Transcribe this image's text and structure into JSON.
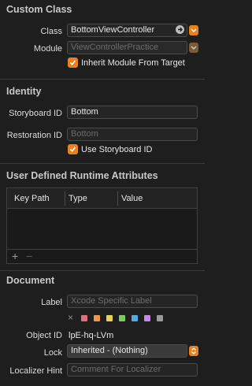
{
  "custom_class": {
    "title": "Custom Class",
    "class_label": "Class",
    "class_value": "BottomViewController",
    "module_label": "Module",
    "module_value": "ViewControllerPractice",
    "inherit_label": "Inherit Module From Target",
    "inherit_checked": true
  },
  "identity": {
    "title": "Identity",
    "storyboard_id_label": "Storyboard ID",
    "storyboard_id_value": "Bottom",
    "restoration_id_label": "Restoration ID",
    "restoration_id_placeholder": "Bottom",
    "use_storyboard_label": "Use Storyboard ID",
    "use_storyboard_checked": true
  },
  "runtime_attributes": {
    "title": "User Defined Runtime Attributes",
    "columns": [
      "Key Path",
      "Type",
      "Value"
    ],
    "add_label": "+",
    "remove_label": "−"
  },
  "document": {
    "title": "Document",
    "label_label": "Label",
    "label_placeholder": "Xcode Specific Label",
    "clear_label": "×",
    "label_colors": [
      "#e0707a",
      "#e89a55",
      "#e6d35a",
      "#7bc865",
      "#5aa8e0",
      "#c68adf",
      "#9a9a9a"
    ],
    "object_id_label": "Object ID",
    "object_id_value": "lpE-hq-LVm",
    "lock_label": "Lock",
    "lock_value": "Inherited - (Nothing)",
    "localizer_label": "Localizer Hint",
    "localizer_placeholder": "Comment For Localizer"
  },
  "colors": {
    "accent": "#e8821f",
    "background": "#1e1e1e"
  }
}
